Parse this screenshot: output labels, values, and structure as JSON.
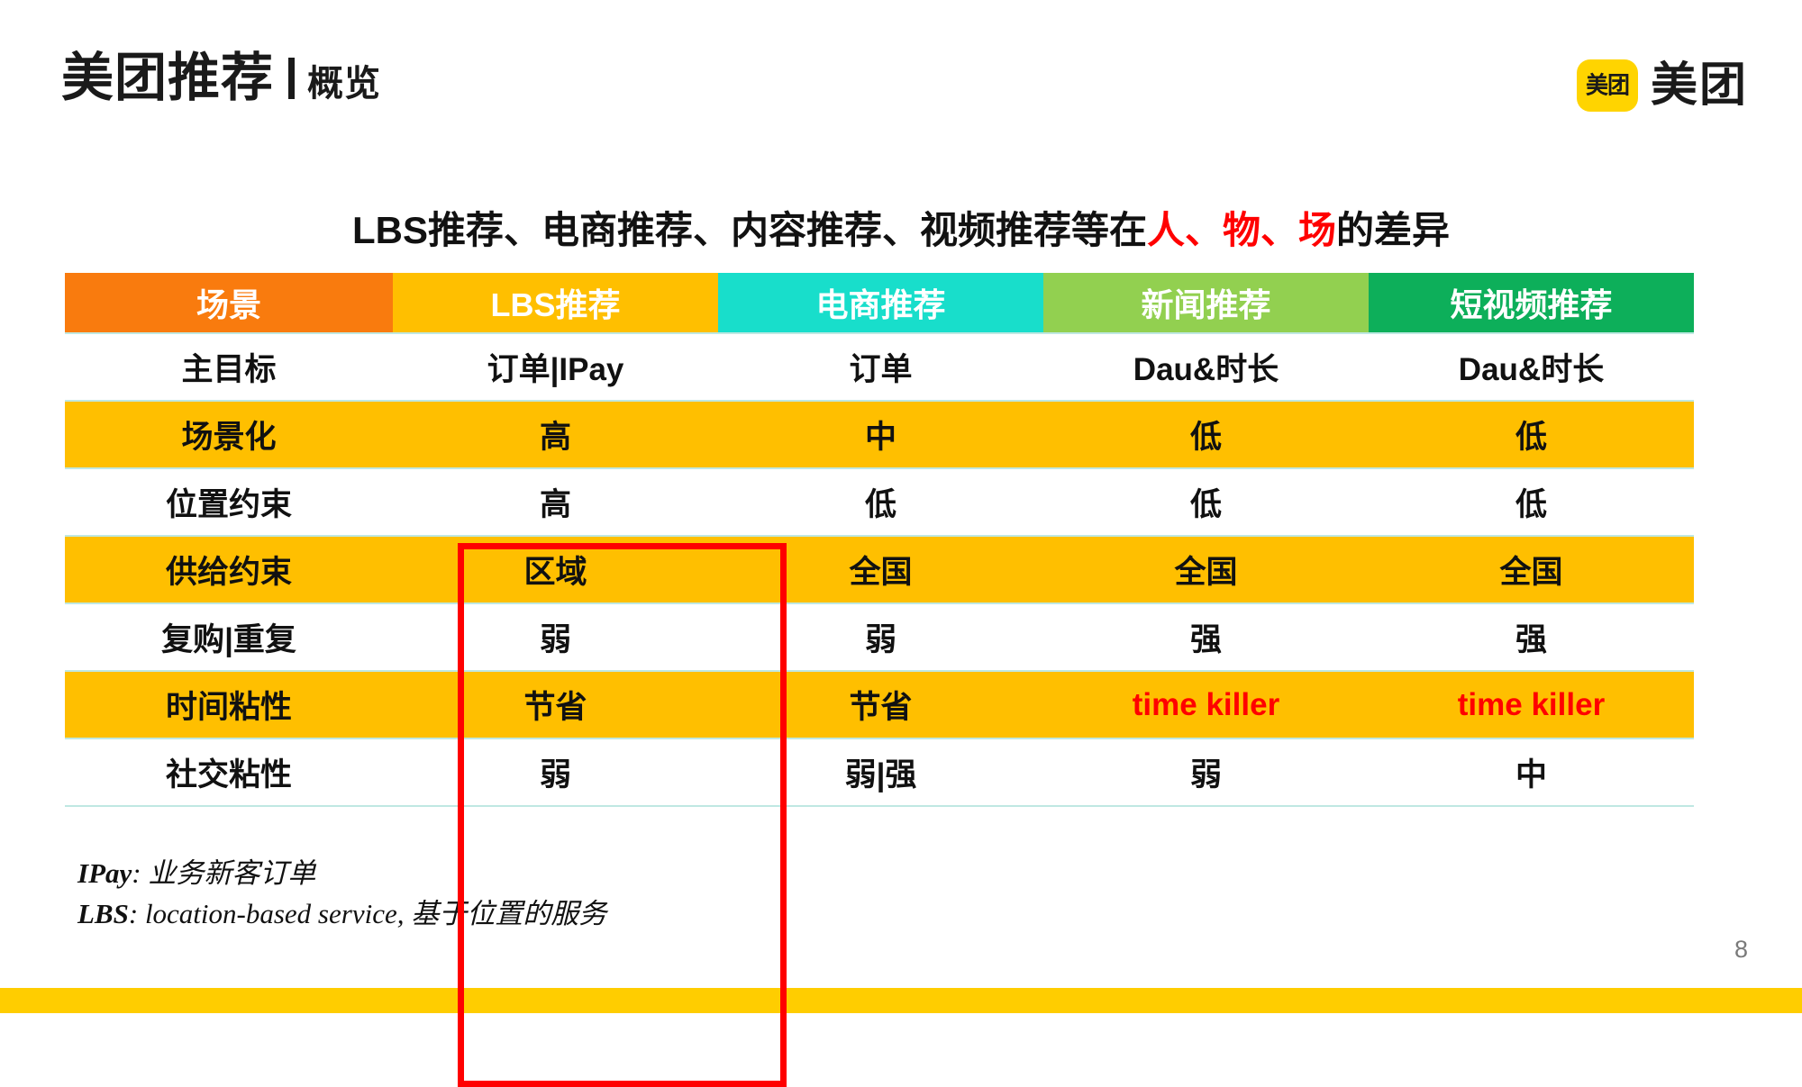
{
  "header": {
    "title_main": "美团推荐",
    "divider": "|",
    "title_sub": "概览",
    "logo_mark_text": "美团",
    "logo_wordmark": "美团"
  },
  "section": {
    "heading_part1": "LBS推荐、电商推荐、内容推荐、视频推荐等在",
    "heading_highlight": "人、物、场",
    "heading_part2": "的差异",
    "highlight_color": "#FF0000"
  },
  "table": {
    "columns": [
      {
        "label": "场景",
        "color": "#F97B0E"
      },
      {
        "label": "LBS推荐",
        "color": "#FFBF00"
      },
      {
        "label": "电商推荐",
        "color": "#18DECB"
      },
      {
        "label": "新闻推荐",
        "color": "#92D050"
      },
      {
        "label": "短视频推荐",
        "color": "#0DAF5A"
      }
    ],
    "rows": [
      {
        "label": "主目标",
        "values": [
          "订单|IPay",
          "订单",
          "Dau&时长",
          "Dau&时长"
        ],
        "shade": "white"
      },
      {
        "label": "场景化",
        "values": [
          "高",
          "中",
          "低",
          "低"
        ],
        "shade": "gold"
      },
      {
        "label": "位置约束",
        "values": [
          "高",
          "低",
          "低",
          "低"
        ],
        "shade": "white"
      },
      {
        "label": "供给约束",
        "values": [
          "区域",
          "全国",
          "全国",
          "全国"
        ],
        "shade": "gold"
      },
      {
        "label": "复购|重复",
        "values": [
          "弱",
          "弱",
          "强",
          "强"
        ],
        "shade": "white"
      },
      {
        "label": "时间粘性",
        "values": [
          "节省",
          "节省",
          "time killer",
          "time killer"
        ],
        "shade": "gold",
        "red_cells": [
          2,
          3
        ]
      },
      {
        "label": "社交粘性",
        "values": [
          "弱",
          "弱|强",
          "弱",
          "中"
        ],
        "shade": "white"
      }
    ],
    "highlight_column": "LBS推荐",
    "highlight_border_color": "#FF0000"
  },
  "footnotes": [
    {
      "term": "IPay",
      "sep": ": ",
      "text": "业务新客订单"
    },
    {
      "term": "LBS",
      "sep": ": ",
      "text": "location-based service, 基于位置的服务"
    }
  ],
  "footer": {
    "page_number": "8",
    "bar_color": "#FFCD00"
  }
}
